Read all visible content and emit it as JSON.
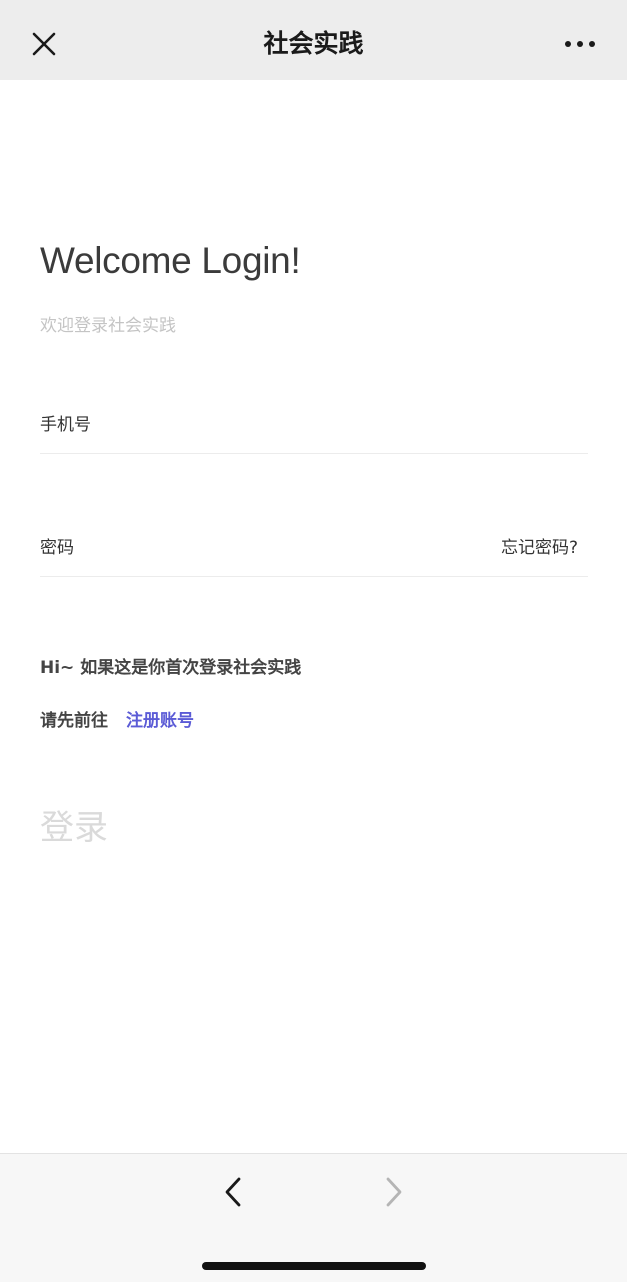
{
  "header": {
    "title": "社会实践",
    "close_icon": "close-icon",
    "more_icon": "more-dots-icon"
  },
  "login": {
    "welcome": "Welcome Login!",
    "subtitle": "欢迎登录社会实践",
    "phone_label": "手机号",
    "phone_value": "",
    "password_label": "密码",
    "password_value": "",
    "forgot_password": "忘记密码?",
    "hint_first_time": "Hi~ 如果这是你首次登录社会实践",
    "hint_go": "请先前往",
    "register_link": "注册账号",
    "submit_label": "登录"
  },
  "footer": {
    "back_icon": "chevron-left-icon",
    "forward_icon": "chevron-right-icon"
  },
  "colors": {
    "header_bg": "#ededed",
    "link": "#5b5bd6",
    "submit_disabled": "#dadada",
    "placeholder_gray": "#c4c4c4"
  }
}
